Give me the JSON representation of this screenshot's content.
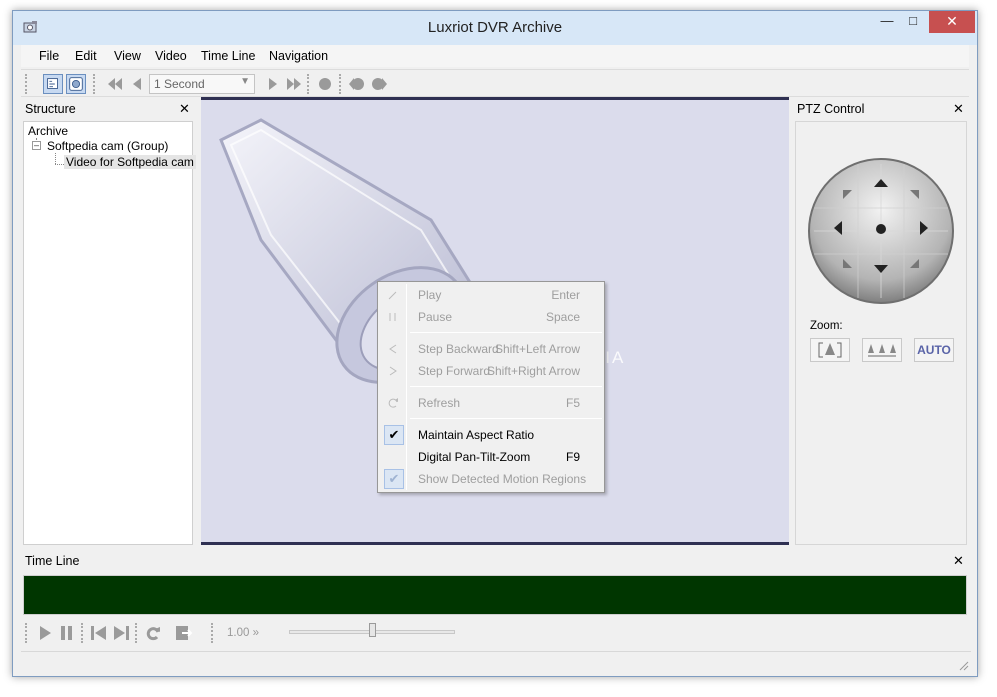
{
  "window": {
    "title": "Luxriot DVR Archive"
  },
  "menu": [
    "File",
    "Edit",
    "View",
    "Video",
    "Time Line",
    "Navigation"
  ],
  "toolbar": {
    "speed_selected": "1 Second"
  },
  "structure": {
    "title": "Structure",
    "tree": {
      "root": "Archive",
      "group": "Softpedia cam (Group)",
      "camera": "Video for Softpedia cam"
    }
  },
  "ptz": {
    "title": "PTZ Control",
    "zoom_label": "Zoom:",
    "auto_label": "AUTO"
  },
  "timeline": {
    "title": "Time Line",
    "speed_value": "1.00 »",
    "slider_position": 0.5
  },
  "context_menu": {
    "items": [
      {
        "label": "Play",
        "shortcut": "Enter",
        "enabled": false
      },
      {
        "label": "Pause",
        "shortcut": "Space",
        "enabled": false
      },
      {
        "label": "Step Backward",
        "shortcut": "Shift+Left Arrow",
        "enabled": false
      },
      {
        "label": "Step Forward",
        "shortcut": "Shift+Right Arrow",
        "enabled": false
      },
      {
        "label": "Refresh",
        "shortcut": "F5",
        "enabled": false
      },
      {
        "label": "Maintain Aspect Ratio",
        "shortcut": "",
        "enabled": true,
        "checked": true
      },
      {
        "label": "Digital Pan-Tilt-Zoom",
        "shortcut": "F9",
        "enabled": true,
        "checked": false
      },
      {
        "label": "Show Detected Motion Regions",
        "shortcut": "",
        "enabled": false,
        "checked": true
      }
    ]
  },
  "colors": {
    "timeline_track": "#003600",
    "video_background": "#dbdcec",
    "titlebar": "#d7e7f7",
    "close_button": "#c75050"
  },
  "watermark": "SOFTPEDIA"
}
